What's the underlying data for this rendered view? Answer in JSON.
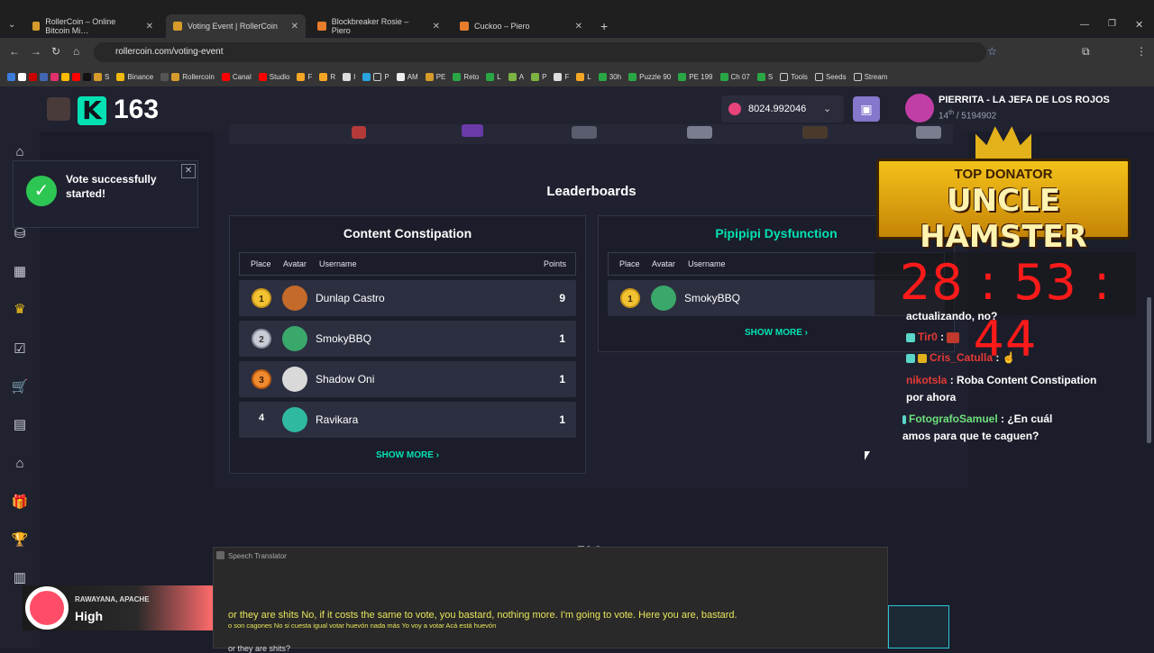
{
  "browser": {
    "tabs": [
      {
        "title": "RollerCoin – Online Bitcoin Mi…",
        "active": false
      },
      {
        "title": "Voting Event | RollerCoin",
        "active": true
      },
      {
        "title": "Blockbreaker Rosie – Piero",
        "active": false
      },
      {
        "title": "Cuckoo – Piero",
        "active": false
      }
    ],
    "url": "rollercoin.com/voting-event",
    "bookmarks": [
      "S",
      "Binance",
      "Rollercoin",
      "Canal",
      "Studio",
      "F",
      "R",
      "I",
      "P",
      "AM",
      "PE",
      "Reto",
      "L",
      "A",
      "P",
      "F",
      "L",
      "30h",
      "Puzzle 90",
      "PE 199",
      "Ch 07",
      "S",
      "Tools",
      "Seeds",
      "Stream"
    ]
  },
  "header": {
    "level": "163",
    "balance": "8024.992046",
    "user_name": "PIERRITA - LA JEFA DE LOS ROJOS",
    "user_rank_pos": "14",
    "user_rank_suffix": "th",
    "user_rank_total": "/ 5194902"
  },
  "toast": {
    "message": "Vote successfully started!"
  },
  "leaderboards": {
    "title": "Leaderboards",
    "columns": {
      "place": "Place",
      "avatar": "Avatar",
      "username": "Username",
      "points": "Points"
    },
    "boards": [
      {
        "title": "Content Constipation",
        "title_color": "#ffffff",
        "rows": [
          {
            "place": "1",
            "username": "Dunlap Castro",
            "points": "9"
          },
          {
            "place": "2",
            "username": "SmokyBBQ",
            "points": "1"
          },
          {
            "place": "3",
            "username": "Shadow Oni",
            "points": "1"
          },
          {
            "place": "4",
            "username": "Ravikara",
            "points": "1"
          }
        ],
        "show_more": "SHOW MORE"
      },
      {
        "title": "Pipipipi Dysfunction",
        "title_color": "#03e1b3",
        "rows": [
          {
            "place": "1",
            "username": "SmokyBBQ",
            "points": ""
          }
        ],
        "show_more": "SHOW MORE"
      }
    ]
  },
  "faq_partial": "FAQ",
  "stream_overlay": {
    "donator_label": "TOP DONATOR",
    "donator_name": "UNCLE HAMSTER",
    "timer": "28 : 53 : 44",
    "chat": [
      {
        "user": "",
        "text": "actualizando, no?"
      },
      {
        "user": "Tir0",
        "text": ""
      },
      {
        "user": "Cris_Catulla",
        "text": ""
      },
      {
        "user": "nikotsla",
        "text": "Roba Content Constipation por ahora"
      },
      {
        "user": "FotografoSamuel",
        "text": "¿En cuál amos para que te caguen?"
      }
    ]
  },
  "translator": {
    "title": "Speech Translator",
    "line1": "or they are shits No, if it costs the same to vote, you bastard, nothing more. I'm going to vote. Here you are, bastard.",
    "line2": "o son cagones No si cuesta igual votar huevón nada más Yo voy a votar Acá está huevón",
    "line3": "or they are shits?"
  },
  "music": {
    "artist": "RAWAYANA, APACHE",
    "title": "High"
  }
}
